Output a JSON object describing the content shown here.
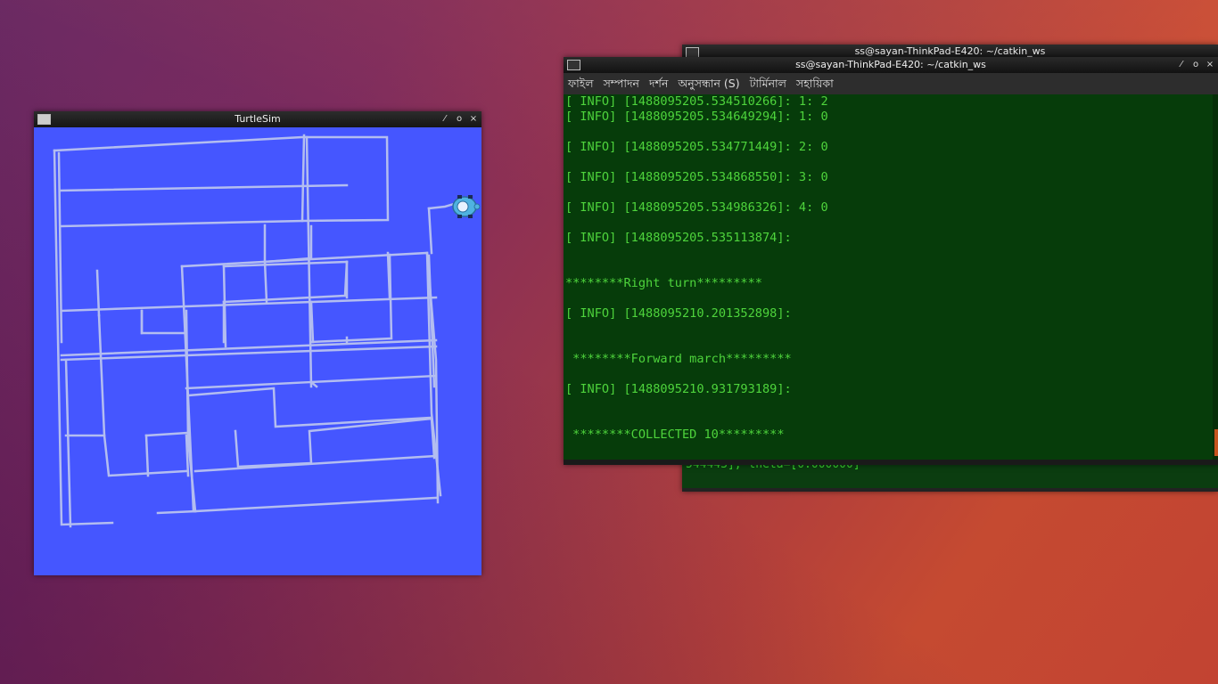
{
  "turtlesim": {
    "title": "TurtleSim",
    "controls": [
      "⁄",
      "o",
      "×"
    ],
    "background_color": "#4556ff",
    "pen_color": "#b3bdf0"
  },
  "terminal_back": {
    "title": "ss@sayan-ThinkPad-E420: ~/catkin_ws",
    "controls": [
      "⁄",
      "o",
      "×"
    ],
    "visible_line": "544443], theta=[0.000000]",
    "cursor": "_"
  },
  "terminal_front": {
    "title": "ss@sayan-ThinkPad-E420: ~/catkin_ws",
    "controls": [
      "⁄",
      "o",
      "×"
    ],
    "menu": [
      "ফাইল",
      "সম্পাদন",
      "দর্শন",
      "অনুসন্ধান (S)",
      "টার্মিনাল",
      "সহায়িকা"
    ],
    "lines": [
      "[ INFO] [1488095205.534510266]: 1: 2",
      "[ INFO] [1488095205.534649294]: 1: 0",
      "",
      "[ INFO] [1488095205.534771449]: 2: 0",
      "",
      "[ INFO] [1488095205.534868550]: 3: 0",
      "",
      "[ INFO] [1488095205.534986326]: 4: 0",
      "",
      "[ INFO] [1488095205.535113874]:",
      "",
      "",
      "********Right turn*********",
      "",
      "[ INFO] [1488095210.201352898]:",
      "",
      "",
      " ********Forward march*********",
      "",
      "[ INFO] [1488095210.931793189]:",
      "",
      "",
      " ********COLLECTED 10*********"
    ]
  }
}
